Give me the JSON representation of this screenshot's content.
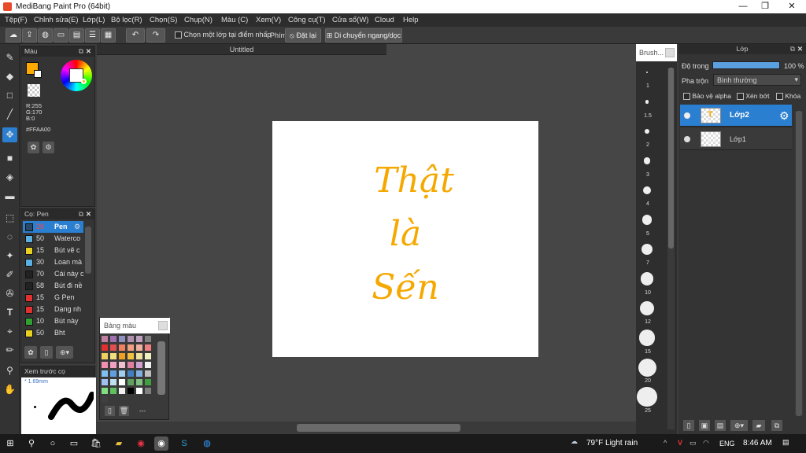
{
  "app": {
    "title": "MediBang Paint Pro (64bit)"
  },
  "menu": [
    "Tệp(F)",
    "Chỉnh sửa(E)",
    "Lớp(L)",
    "Bộ lọc(R)",
    "Chọn(S)",
    "Chụp(N)",
    "Màu (C)",
    "Xem(V)",
    "Công cụ(T)",
    "Cửa sổ(W)",
    "Cloud",
    "Help"
  ],
  "toolbar": {
    "select_layer_label": "Chọn một lớp tại điểm nhấp",
    "key_label": "Phím",
    "reset_label": "Đặt lại",
    "move_label": "Di chuyển ngang/dọc"
  },
  "color_panel": {
    "title": "Màu",
    "r": "R:255",
    "g": "G:170",
    "b": "B:0",
    "hex": "#FFAA00",
    "fg_color": "#ffaa00"
  },
  "brush_panel": {
    "title": "Cọ: Pen",
    "items": [
      {
        "size": "20",
        "name": "Pen",
        "color": "#2b4a6a",
        "selected": true
      },
      {
        "size": "50",
        "name": "Waterco",
        "color": "#5ab0e0"
      },
      {
        "size": "15",
        "name": "Bút vẽ c",
        "color": "#e8d020"
      },
      {
        "size": "30",
        "name": "Loan mà",
        "color": "#5ab0e0"
      },
      {
        "size": "70",
        "name": "Cái này c",
        "color": "#222222"
      },
      {
        "size": "58",
        "name": "Bút đi nề",
        "color": "#222222"
      },
      {
        "size": "15",
        "name": "G Pen",
        "color": "#e03030"
      },
      {
        "size": "15",
        "name": "Dạng nh",
        "color": "#e03030"
      },
      {
        "size": "10",
        "name": "Bút này",
        "color": "#30a030"
      },
      {
        "size": "50",
        "name": "Bht",
        "color": "#e8d020"
      }
    ]
  },
  "palette_panel": {
    "title": "Bảng màu",
    "extra": "---"
  },
  "preview_panel": {
    "title": "Xem trước cọ",
    "size": "1.69mm"
  },
  "canvas": {
    "tab_title": "Untitled",
    "text_lines": [
      "Thật",
      "là",
      "Sến"
    ],
    "text_color": "#f5a800"
  },
  "brush_size_panel": {
    "title": "Brush...",
    "sizes": [
      "1",
      "1.5",
      "2",
      "3",
      "4",
      "5",
      "7",
      "10",
      "12",
      "15",
      "20",
      "25"
    ]
  },
  "layer_panel": {
    "title": "Lớp",
    "opacity_label": "Độ trong",
    "opacity_value": "100 %",
    "blend_label": "Pha trộn",
    "blend_value": "Bình thường",
    "protect_alpha": "Bảo vệ alpha",
    "clip": "Xén bớt",
    "lock": "Khóa",
    "layers": [
      {
        "name": "Lớp2",
        "selected": true
      },
      {
        "name": "Lớp1",
        "selected": false
      }
    ]
  },
  "taskbar": {
    "weather": "79°F  Light rain",
    "lang": "ENG",
    "time": "8:46 AM"
  }
}
